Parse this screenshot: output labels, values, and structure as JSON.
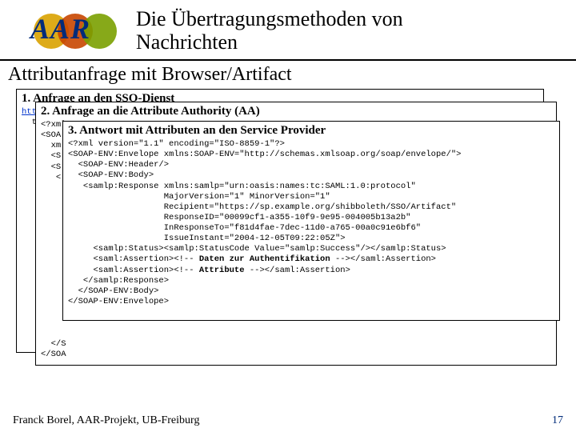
{
  "logo_text": "AAR",
  "title_line1": "Die Übertragungsmethoden von",
  "title_line2": "Nachrichten",
  "subtitle": "Attributanfrage mit Browser/Artifact",
  "card1": {
    "title": "1. Anfrage an den SSO-Dienst",
    "pre_l1": "htt",
    "pre_l2": "  t"
  },
  "card2": {
    "title": "2. Anfrage an die Attribute Authority (AA)",
    "pre_l1": "<?xml",
    "pre_l2": "<SOA",
    "pre_l3": "  xm",
    "pre_l4": "  <S",
    "pre_l5": "  <S",
    "pre_l6": "   <",
    "pre_t1": "  </S",
    "pre_t2": "</SOA"
  },
  "card3": {
    "title": "3. Antwort mit Attributen an den Service Provider",
    "lines": [
      "<?xml version=\"1.1\" encoding=\"ISO-8859-1\"?>",
      "<SOAP-ENV:Envelope xmlns:SOAP-ENV=\"http://schemas.xmlsoap.org/soap/envelope/\">",
      "  <SOAP-ENV:Header/>",
      "  <SOAP-ENV:Body>",
      "   <samlp:Response xmlns:samlp=\"urn:oasis:names:tc:SAML:1.0:protocol\"",
      "                   MajorVersion=\"1\" MinorVersion=\"1\"",
      "                   Recipient=\"https://sp.example.org/shibboleth/SSO/Artifact\"",
      "                   ResponseID=\"00099cf1-a355-10f9-9e95-004005b13a2b\"",
      "                   InResponseTo=\"f81d4fae-7dec-11d0-a765-00a0c91e6bf6\"",
      "                   IssueInstant=\"2004-12-05T09:22:05Z\">",
      "     <samlp:Status><samlp:StatusCode Value=\"samlp:Success\"/></samlp:Status>",
      "     <saml:Assertion><!-- §B§Daten zur Authentifikation§/B§ --></saml:Assertion>",
      "     <saml:Assertion><!-- §B§Attribute§/B§ --></saml:Assertion>",
      "   </samlp:Response>",
      "  </SOAP-ENV:Body>",
      "</SOAP-ENV:Envelope>"
    ]
  },
  "footer_left": "Franck Borel, AAR-Projekt, UB-Freiburg",
  "footer_right": "17"
}
